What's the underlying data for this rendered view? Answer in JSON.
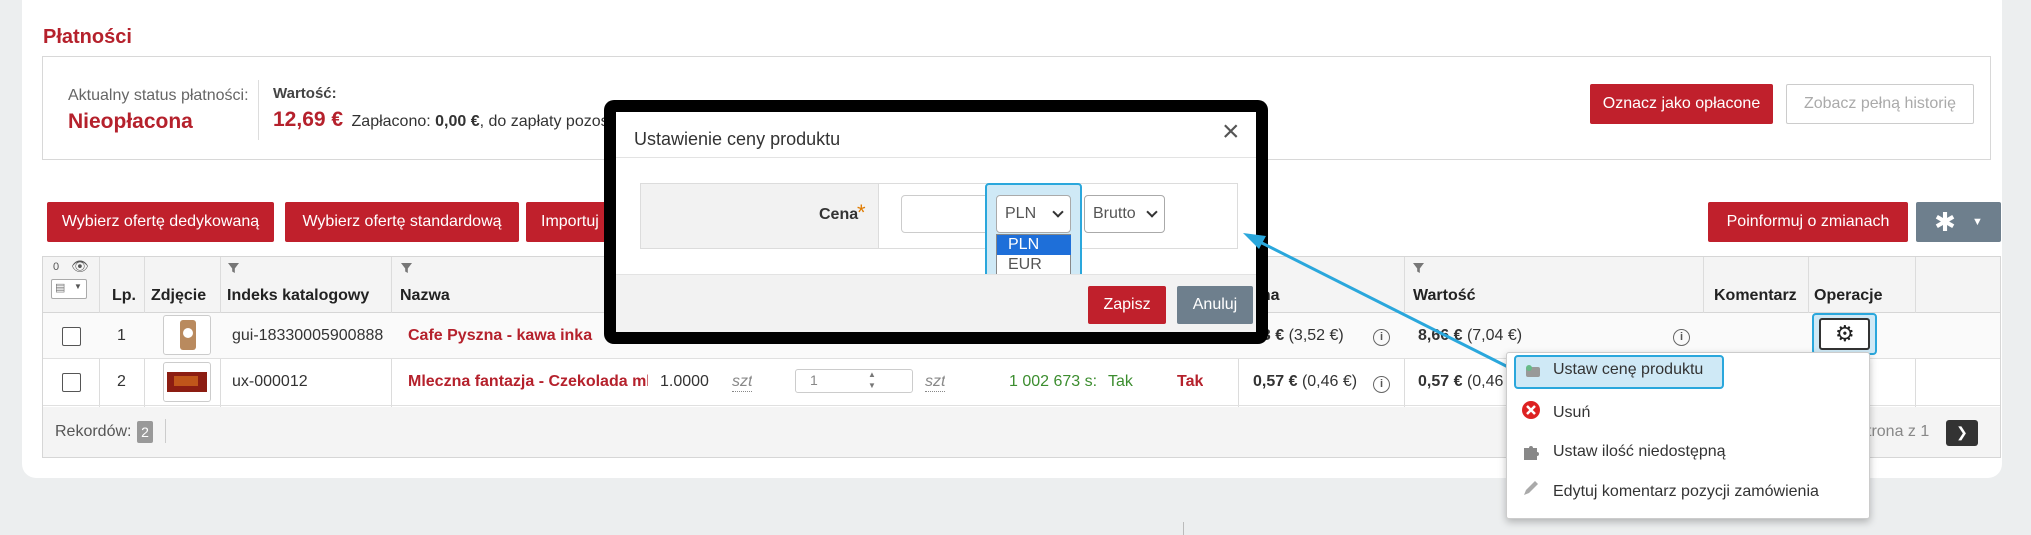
{
  "payments": {
    "title": "Płatności",
    "status_label": "Aktualny status płatności:",
    "status_value": "Nieopłacona",
    "value_label": "Wartość:",
    "amount": "12,69 €",
    "paid_text_prefix": "Zapłacono:",
    "paid_amount": "0,00 €",
    "due_text": ", do zapłaty pozos",
    "mark_paid_button": "Oznacz jako opłacone",
    "history_button": "Zobacz pełną historię"
  },
  "toolbar": {
    "dedicated_offer": "Wybierz ofertę dedykowaną",
    "standard_offer": "Wybierz ofertę standardową",
    "import": "Importuj",
    "inform_changes": "Poinformuj o zmianach"
  },
  "table": {
    "visible_count": "0",
    "headers": {
      "lp": "Lp.",
      "photo": "Zdjęcie",
      "index": "Indeks katalogowy",
      "name": "Nazwa",
      "price": "ena",
      "value": "Wartość",
      "comment": "Komentarz",
      "operations": "Operacje"
    },
    "rows": [
      {
        "lp": "1",
        "index": "gui-18330005900888",
        "name": "Cafe Pyszna - kawa inka",
        "price_bold": "33 €",
        "price_net": "(3,52 €)",
        "value_bold": "8,66 €",
        "value_net": "(7,04 €)"
      },
      {
        "lp": "2",
        "index": "ux-000012",
        "name": "Mleczna fantazja - Czekolada ml",
        "qty": "1.0000",
        "unit": "szt",
        "stepper": "1",
        "unit2": "szt",
        "stock": "1 002 673 s:",
        "flag1": "Tak",
        "flag2": "Tak",
        "price_bold": "0,57 €",
        "price_net": "(0,46 €)",
        "value_bold": "0,57 €",
        "value_net": "(0,46"
      }
    ],
    "footer_records_label": "Rekordów:",
    "footer_records_count": "2",
    "footer_page": "strona z 1"
  },
  "modal": {
    "title": "Ustawienie ceny produktu",
    "price_label": "Cena",
    "required_mark": "*",
    "currency_selected": "PLN",
    "currency_options": [
      "PLN",
      "EUR"
    ],
    "gross_selected": "Brutto",
    "save_button": "Zapisz",
    "cancel_button": "Anuluj"
  },
  "context_menu": {
    "items": [
      {
        "label": "Ustaw cenę produktu",
        "icon": "price-tag-icon"
      },
      {
        "label": "Usuń",
        "icon": "delete-icon"
      },
      {
        "label": "Ustaw ilość niedostępną",
        "icon": "puzzle-icon"
      },
      {
        "label": "Edytuj komentarz pozycji zamówienia",
        "icon": "pencil-icon"
      }
    ]
  },
  "colors": {
    "brand_red": "#c0202c",
    "highlight_blue": "#2aa7dc",
    "link_red": "#b5212c",
    "green": "#3c8d2f"
  }
}
